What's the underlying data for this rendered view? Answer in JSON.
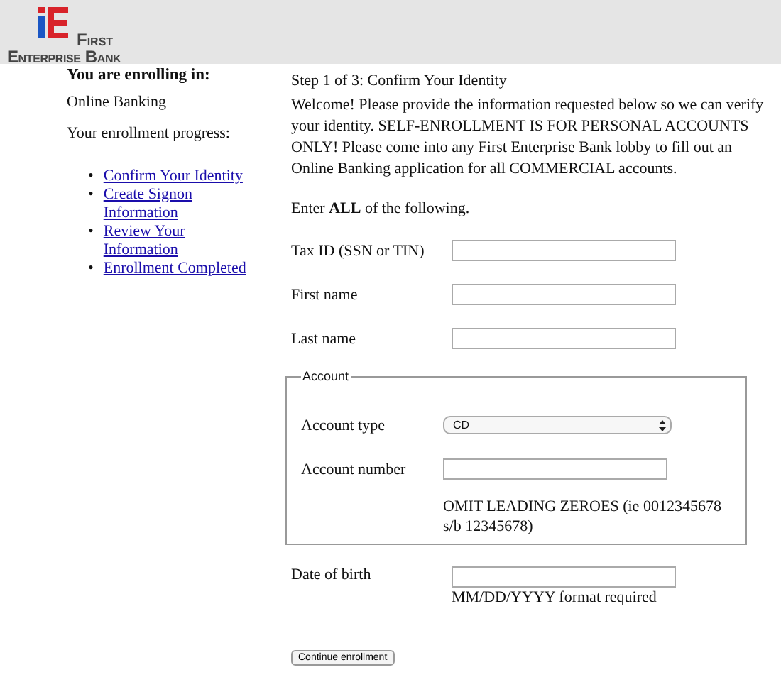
{
  "logo": {
    "line_1": "First",
    "line_2": "Enterprise Bank"
  },
  "sidebar": {
    "heading": "You are enrolling in:",
    "product": "Online Banking",
    "progress_label": "Your enrollment progress:",
    "steps": [
      {
        "marker": "•",
        "label": "Confirm Your Identity"
      },
      {
        "marker": "•",
        "label": "Create Signon Information"
      },
      {
        "marker": "•",
        "label": "Review Your Information"
      },
      {
        "marker": "•",
        "label": "Enrollment Completed"
      }
    ]
  },
  "step_title": "Step 1 of 3: Confirm Your Identity",
  "intro": "Welcome! Please provide the information requested below so we can verify your identity. SELF-ENROLLMENT IS FOR PERSONAL ACCOUNTS ONLY! Please come into any First Enterprise Bank lobby to fill out an Online Banking application for all COMMERCIAL accounts.",
  "instruction": "Enter **ALL** of the following.",
  "fields": [
    {
      "label": "Tax ID (SSN or TIN)"
    },
    {
      "label": "First name"
    },
    {
      "label": "Last name"
    }
  ],
  "account": {
    "legend": "Account",
    "type_label": "Account type",
    "type_value": "CD",
    "number_label": "Account number",
    "number_hint": "OMIT LEADING ZEROES (ie 0012345678 s/b 12345678)"
  },
  "dob": {
    "label": "Date of birth",
    "hint": "MM/DD/YYYY format required"
  },
  "submit": "Continue enrollment"
}
